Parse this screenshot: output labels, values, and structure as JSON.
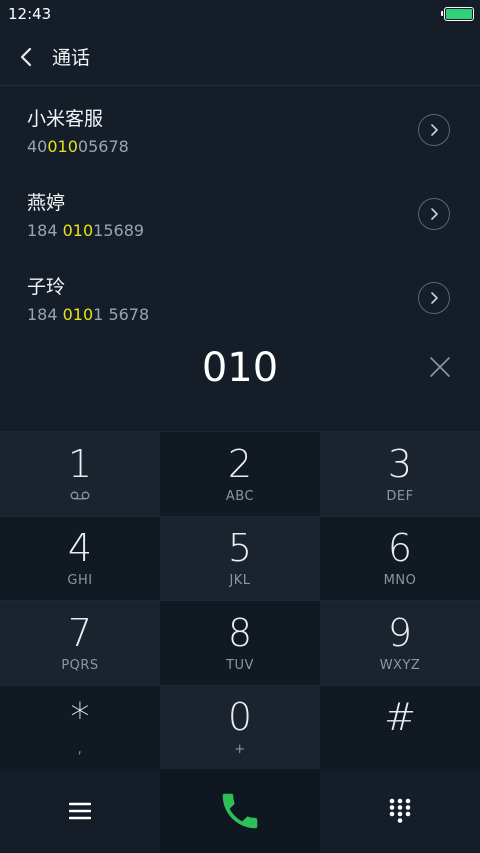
{
  "status": {
    "time": "12:43"
  },
  "header": {
    "title": "通话"
  },
  "results": [
    {
      "name": "小米客服",
      "number_pre": "40",
      "number_hl": "010",
      "number_post": "05678"
    },
    {
      "name": "燕婷",
      "number_pre": "184 ",
      "number_hl": "010",
      "number_post": "15689"
    },
    {
      "name": "子玲",
      "number_pre": "184 ",
      "number_hl": "010",
      "number_post": "1 5678"
    }
  ],
  "dialed": "010",
  "keys": [
    {
      "digit": "1",
      "letters": ""
    },
    {
      "digit": "2",
      "letters": "ABC"
    },
    {
      "digit": "3",
      "letters": "DEF"
    },
    {
      "digit": "4",
      "letters": "GHI"
    },
    {
      "digit": "5",
      "letters": "JKL"
    },
    {
      "digit": "6",
      "letters": "MNO"
    },
    {
      "digit": "7",
      "letters": "PQRS"
    },
    {
      "digit": "8",
      "letters": "TUV"
    },
    {
      "digit": "9",
      "letters": "WXYZ"
    },
    {
      "digit": "*",
      "letters": ","
    },
    {
      "digit": "0",
      "letters": "+"
    },
    {
      "digit": "#",
      "letters": ""
    }
  ],
  "colors": {
    "highlight": "#e6e21a",
    "call": "#2fbf5a",
    "battery": "#2fd27a"
  },
  "icons": {
    "back": "chevron-left-icon",
    "detail": "chevron-right-circle-icon",
    "clear": "close-icon",
    "voicemail": "voicemail-icon",
    "menu": "menu-icon",
    "call": "phone-icon",
    "keypad": "dialpad-icon"
  }
}
